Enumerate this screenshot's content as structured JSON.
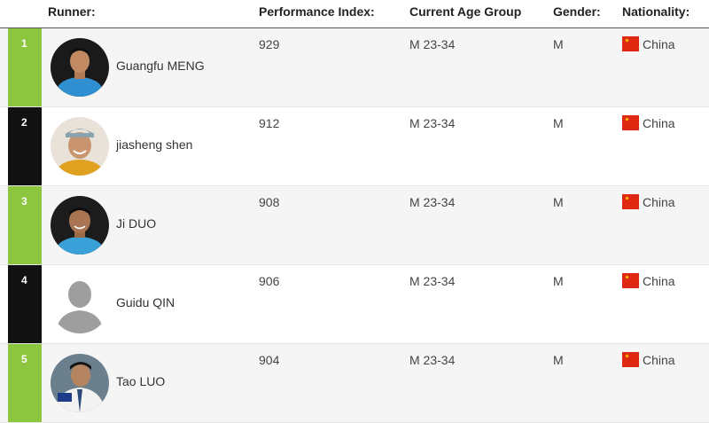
{
  "headers": {
    "runner": "Runner:",
    "performance": "Performance Index:",
    "age_group": "Current Age Group",
    "gender": "Gender:",
    "nationality": "Nationality:"
  },
  "rows": [
    {
      "rank": "1",
      "name": "Guangfu MENG",
      "performance": "929",
      "age_group": "M 23-34",
      "gender": "M",
      "nationality": "China",
      "rank_color": "#8cc63f",
      "avatar": "runner-photo"
    },
    {
      "rank": "2",
      "name": "jiasheng shen",
      "performance": "912",
      "age_group": "M 23-34",
      "gender": "M",
      "nationality": "China",
      "rank_color": "#111111",
      "avatar": "runner-photo"
    },
    {
      "rank": "3",
      "name": "Ji DUO",
      "performance": "908",
      "age_group": "M 23-34",
      "gender": "M",
      "nationality": "China",
      "rank_color": "#8cc63f",
      "avatar": "runner-photo"
    },
    {
      "rank": "4",
      "name": "Guidu QIN",
      "performance": "906",
      "age_group": "M 23-34",
      "gender": "M",
      "nationality": "China",
      "rank_color": "#111111",
      "avatar": "placeholder-silhouette"
    },
    {
      "rank": "5",
      "name": "Tao LUO",
      "performance": "904",
      "age_group": "M 23-34",
      "gender": "M",
      "nationality": "China",
      "rank_color": "#8cc63f",
      "avatar": "runner-photo"
    }
  ]
}
